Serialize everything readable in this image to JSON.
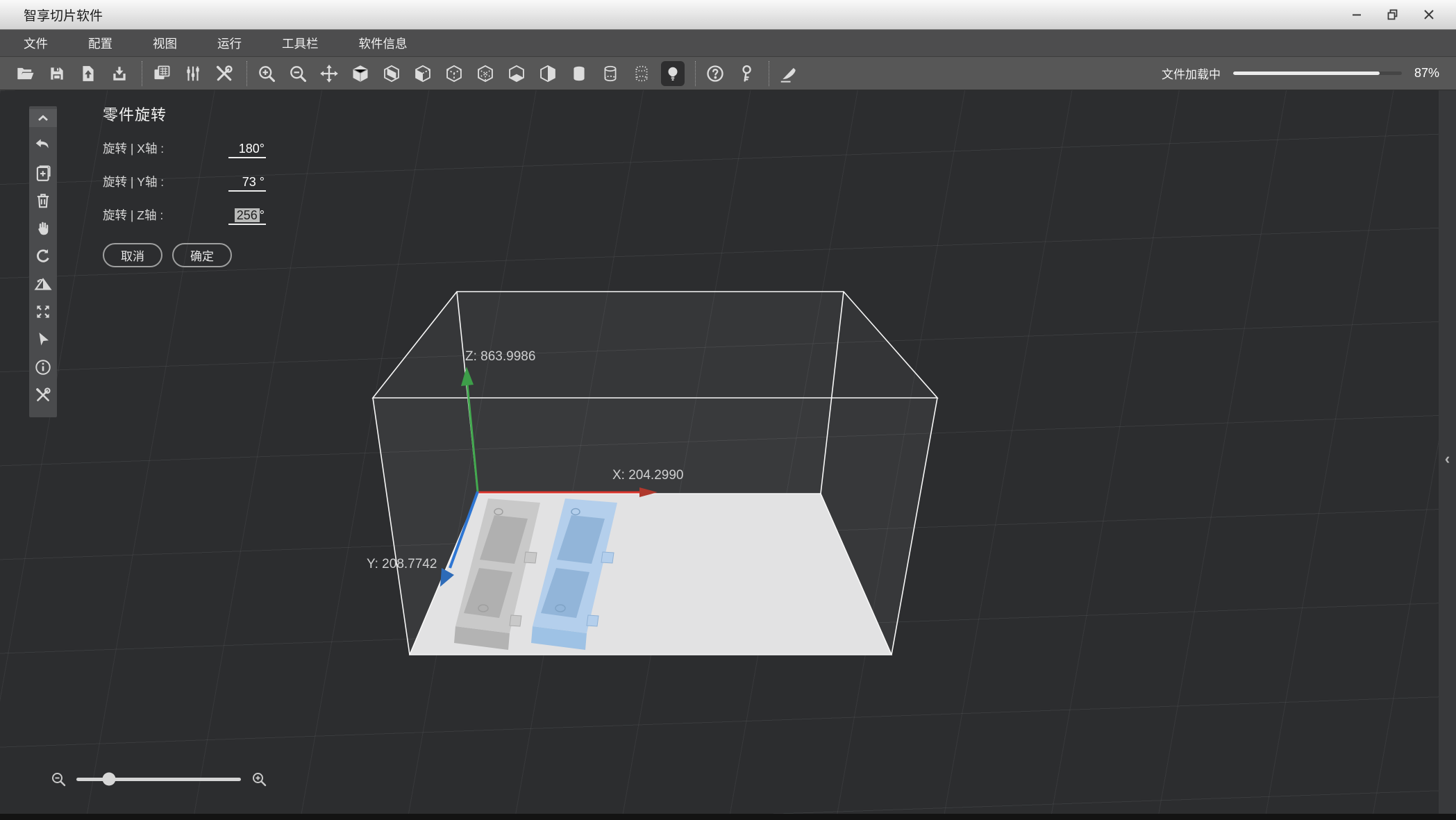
{
  "window": {
    "title": "智享切片软件",
    "controls": [
      {
        "name": "minimize",
        "label": "minimize"
      },
      {
        "name": "restore",
        "label": "restore"
      },
      {
        "name": "close",
        "label": "close"
      }
    ]
  },
  "menu": {
    "items": [
      {
        "name": "file",
        "label": "文件"
      },
      {
        "name": "config",
        "label": "配置"
      },
      {
        "name": "view",
        "label": "视图"
      },
      {
        "name": "run",
        "label": "运行"
      },
      {
        "name": "toolbar",
        "label": "工具栏"
      },
      {
        "name": "software-info",
        "label": "软件信息"
      }
    ]
  },
  "toolbar": {
    "items": [
      {
        "name": "open-file",
        "icon": "open-folder"
      },
      {
        "name": "save-file",
        "icon": "save"
      },
      {
        "name": "export-file",
        "icon": "file-export"
      },
      {
        "name": "import-file",
        "icon": "import-tray"
      },
      {
        "sep": true
      },
      {
        "name": "machine-panel",
        "icon": "duplicate-cards"
      },
      {
        "name": "parameter-sliders",
        "icon": "sliders"
      },
      {
        "name": "tools",
        "icon": "tools-cross"
      },
      {
        "sep": true
      },
      {
        "name": "zoom-in",
        "icon": "zoom-in"
      },
      {
        "name": "zoom-out",
        "icon": "zoom-out"
      },
      {
        "name": "move",
        "icon": "move-arrows"
      },
      {
        "name": "view-solid",
        "icon": "cube-solid"
      },
      {
        "name": "view-plane",
        "icon": "cube-sheet"
      },
      {
        "name": "view-open",
        "icon": "cube-open"
      },
      {
        "name": "view-wireframe",
        "icon": "cube-dotted"
      },
      {
        "name": "view-hidden-edges",
        "icon": "cube-inner-dots"
      },
      {
        "name": "view-bottom",
        "icon": "cube-bottom"
      },
      {
        "name": "view-half-section",
        "icon": "cube-half"
      },
      {
        "name": "cylinder-solid-view",
        "icon": "cylinder-solid"
      },
      {
        "name": "cylinder-wireframe-view",
        "icon": "cylinder-wire"
      },
      {
        "name": "cylinder-points-view",
        "icon": "cylinder-dots"
      },
      {
        "name": "light-toggle",
        "icon": "bulb",
        "active": true
      },
      {
        "sep": true
      },
      {
        "name": "help",
        "icon": "help-circle"
      },
      {
        "name": "license-key",
        "icon": "key"
      },
      {
        "sep": true
      },
      {
        "name": "slice-knife",
        "icon": "knife"
      }
    ]
  },
  "status": {
    "label": "文件加载中",
    "percent": 87,
    "percent_text": "87%"
  },
  "sidebar": {
    "items": [
      {
        "name": "collapse-panel",
        "icon": "chevron-up"
      },
      {
        "name": "undo",
        "icon": "undo-arrow"
      },
      {
        "name": "add-part",
        "icon": "doc-plus"
      },
      {
        "name": "delete-part",
        "icon": "trash"
      },
      {
        "name": "pan",
        "icon": "hand"
      },
      {
        "name": "rotate-part",
        "icon": "rotate-ccw"
      },
      {
        "name": "mirror-part",
        "icon": "mirror-triangle"
      },
      {
        "name": "fit-view",
        "icon": "expand-arrows"
      },
      {
        "name": "select",
        "icon": "cursor-arrow"
      },
      {
        "name": "part-info",
        "icon": "info-circle"
      },
      {
        "name": "repair-part",
        "icon": "crossed-tools"
      }
    ]
  },
  "rotate_panel": {
    "title": "零件旋转",
    "rows": [
      {
        "name": "rotation-x",
        "label": "旋转 | X轴 :",
        "value": "180",
        "unit": "°",
        "selected": false
      },
      {
        "name": "rotation-y",
        "label": "旋转 | Y轴 :",
        "value": "73",
        "unit": " °",
        "selected": false
      },
      {
        "name": "rotation-z",
        "label": "旋转 | Z轴 :",
        "value": "256",
        "unit": "°",
        "selected": true
      }
    ],
    "cancel_label": "取消",
    "ok_label": "确定"
  },
  "scene": {
    "axis_labels": {
      "x": "X: 204.2990",
      "y": "Y: 208.7742",
      "z": "Z: 863.9986"
    },
    "colors": {
      "x_axis": "#d8342c",
      "y_axis": "#2e76d3",
      "z_axis": "#43a94f",
      "plate": "#e2e2e3",
      "model_gray": "#c9c9c9",
      "model_blue": "#b4cfec"
    }
  },
  "zoom_control": {
    "value_percent": 20
  }
}
